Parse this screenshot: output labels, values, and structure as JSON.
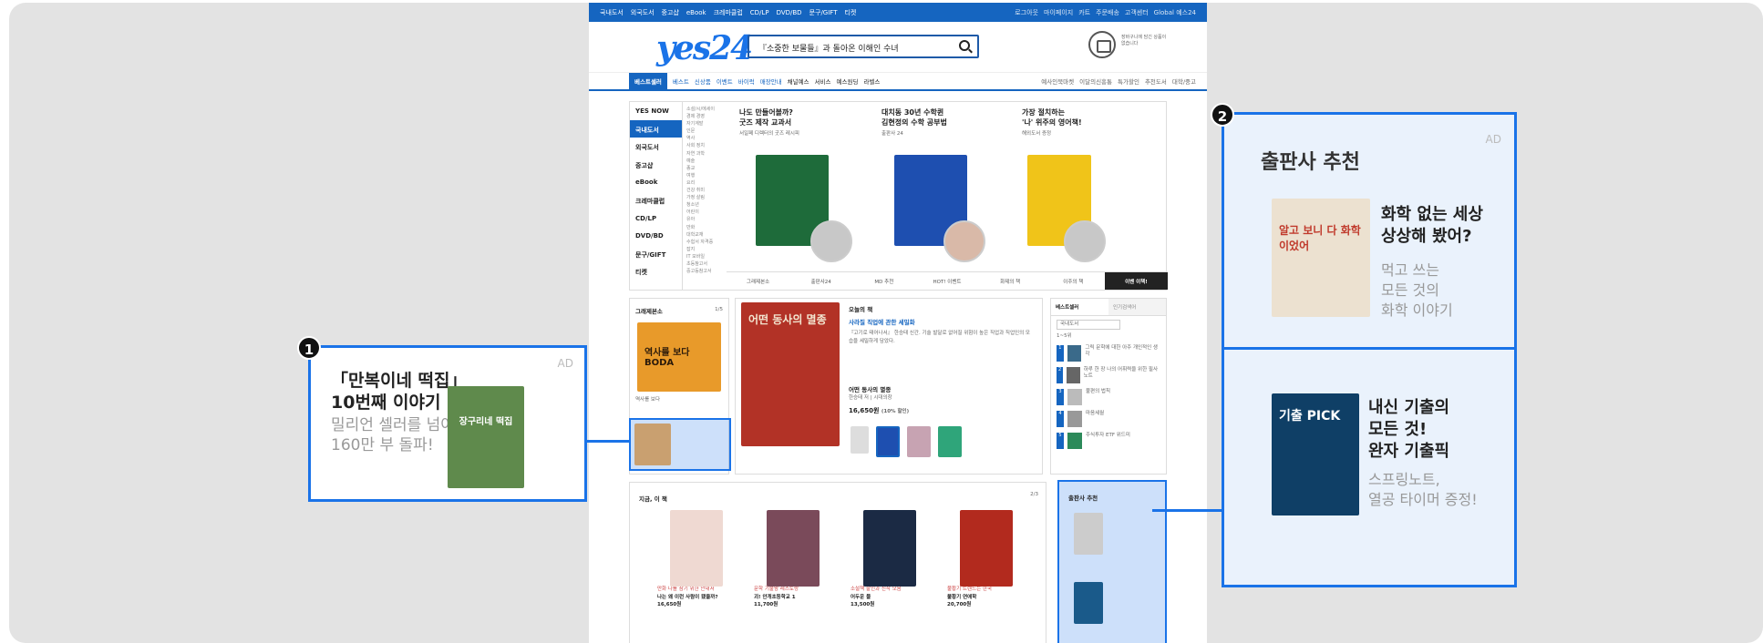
{
  "site": {
    "topbar": {
      "links": [
        "국내도서",
        "외국도서",
        "중고샵",
        "eBook",
        "크레마클럽",
        "CD/LP",
        "DVD/BD",
        "문구/GIFT",
        "티켓"
      ],
      "right": [
        "로그아웃",
        "마이페이지",
        "카트",
        "주문배송",
        "고객센터",
        "Global 예스24"
      ]
    },
    "logo": "yes24",
    "search_query": "『소중한 보물들』과 돌아온 이해인 수녀",
    "cart_note": "장바구니에 담긴 상품이 없습니다",
    "nav": {
      "primary": "베스트셀러",
      "items": [
        "베스트",
        "신상품",
        "이벤트",
        "바이럭",
        "매장안내",
        "채널예스",
        "서비스",
        "예스원딩",
        "라벨스"
      ],
      "right": [
        "예사인북마켓",
        "이달의신흥통",
        "특가할인",
        "추천도서",
        "대학/중고"
      ]
    },
    "categories": [
      "YES NOW",
      "국내도서",
      "외국도서",
      "중고샵",
      "eBook",
      "크레마클럽",
      "CD/LP",
      "DVD/BD",
      "문구/GIFT",
      "티켓"
    ],
    "subcategories": [
      "소설/시/에세이",
      "경제 경영",
      "자기계발",
      "인문",
      "역사",
      "사회 정치",
      "자연 과학",
      "예술",
      "종교",
      "여행",
      "요리",
      "건강 취미",
      "가정 살림",
      "청소년",
      "어린이",
      "유아",
      "만화",
      "대학교재",
      "수험서 자격증",
      "잡지",
      "IT 모바일",
      "초등참고서",
      "중고등참고서"
    ],
    "featured": [
      {
        "title": "나도 만들어볼까?\n굿즈 제작 교과서",
        "sub": "서일페 디렉터의 굿즈 레시피"
      },
      {
        "title": "대치동 30년 수학퀸\n김현정의 수학 공부법",
        "sub": "출판사 24"
      },
      {
        "title": "가장 절치하는\n'나' 위주의 영어책!",
        "sub": "해외도서 증정"
      }
    ],
    "featured_tabs": [
      "그래제본소",
      "출판사24",
      "MD 추천",
      "HOT! 이벤트",
      "화제의 책",
      "이주의 책",
      "이벤 이책!"
    ],
    "grape": {
      "heading": "그래제본소",
      "pager": "1/5",
      "caption": "역사를 보다",
      "book_text": "역사를 보다 BODA"
    },
    "today": {
      "label": "오늘의 책",
      "headline": "사라질 직업에 관한 세밀화",
      "body": "『고기로 태어나서』 한승태 신간. 기술 발달로 없어질 위험이 높은 직업과 직업인의 모습을 세밀하게 담았다.",
      "book_title": "어떤 동사의 멸종",
      "author": "한승태 저 | 시대의창",
      "price": "16,650원",
      "sale": "(10% 할인)",
      "cover_title": "어떤 동사의 멸종"
    },
    "best": {
      "tabs": [
        "베스트셀러",
        "인기검색어"
      ],
      "filter": "국내도서",
      "range": "1~5위",
      "items": [
        {
          "rank": "1",
          "title": "그릭 문학에 대한 아주 개인적인 생각"
        },
        {
          "rank": "2",
          "title": "하루 한 장 나의 어휘력을 위한 필사 노트"
        },
        {
          "rank": "3",
          "title": "불편의 법칙"
        },
        {
          "rank": "4",
          "title": "마음세월"
        },
        {
          "rank": "5",
          "title": "주식투자 ETF 위드미"
        }
      ]
    },
    "now": {
      "heading": "지금, 이 책",
      "pager": "2/3",
      "books": [
        {
          "desc": "만화 나를 참기 위한 안내서",
          "title": "나는 왜 이런 사람이 됐을까?",
          "price": "16,650원"
        },
        {
          "desc": "문학 기불왕 레스토랑",
          "title": "괴! 안개초등학교 1",
          "price": "11,700원"
        },
        {
          "desc": "소설책 할인과 신작 모음",
          "title": "어두운 물",
          "price": "13,500원"
        },
        {
          "desc": "불황기 트렌드는 한국",
          "title": "불황기 연애학",
          "price": "20,700원"
        }
      ]
    },
    "publisher_small": {
      "heading": "출판사 추천"
    }
  },
  "callout1": {
    "ad": "AD",
    "badge": "1",
    "title": "「만복이네 떡집」\n10번째 이야기",
    "sub": "밀리언 셀러를 넘어\n160만 부 돌파!",
    "book_text": "장구리네 떡집"
  },
  "callout2": {
    "ad": "AD",
    "badge": "2",
    "heading": "출판사 추천",
    "item1": {
      "title": "화학 없는 세상\n상상해 봤어?",
      "sub": "먹고 쓰는\n모든 것의\n화학 이야기",
      "cover": "알고 보니 다 화학이었어"
    },
    "item2": {
      "title": "내신 기출의\n모든 것!\n완자 기출픽",
      "sub": "스프링노트,\n열공 타이머 증정!",
      "cover": "기출 PICK"
    }
  },
  "colors": {
    "accent": "#1a73e8",
    "brand": "#1565c0",
    "backdrop": "#e3e3e3"
  }
}
